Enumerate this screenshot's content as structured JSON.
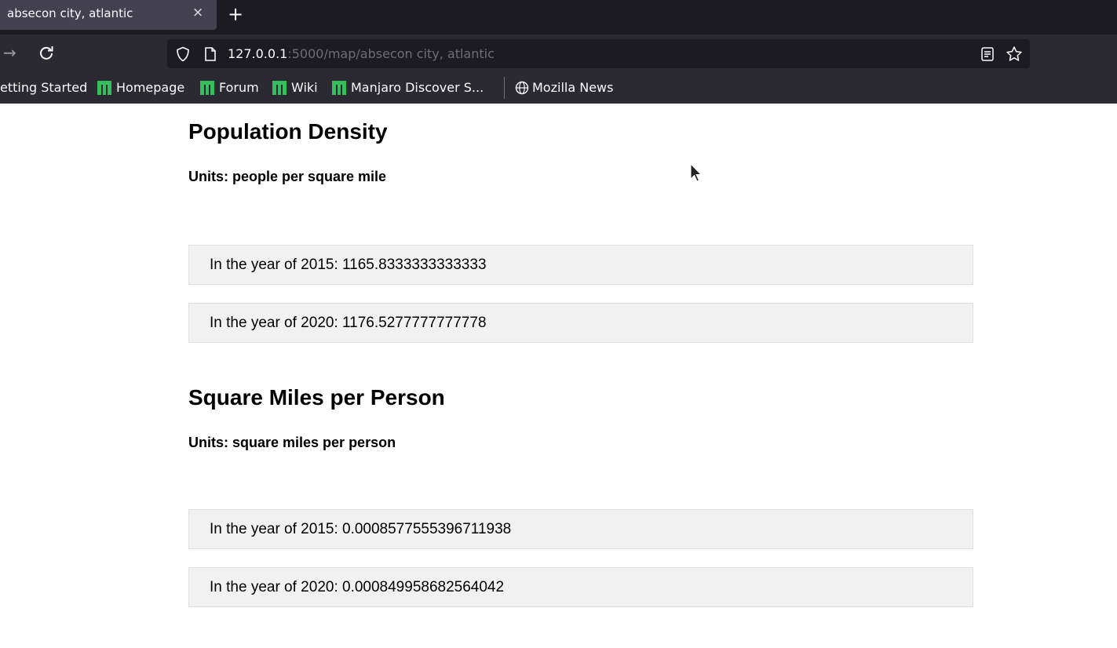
{
  "browser": {
    "tab_title": "absecon city, atlantic",
    "tab_close": "×",
    "new_tab": "+",
    "url_host": "127.0.0.1",
    "url_path": ":5000/map/absecon city, atlantic",
    "bookmarks": [
      {
        "label": "etting Started",
        "icon": "none"
      },
      {
        "label": "Homepage",
        "icon": "manjaro-icon"
      },
      {
        "label": "Forum",
        "icon": "manjaro-icon"
      },
      {
        "label": "Wiki",
        "icon": "manjaro-icon"
      },
      {
        "label": "Manjaro Discover S...",
        "icon": "manjaro-icon"
      },
      {
        "label": "Mozilla News",
        "icon": "globe-icon"
      }
    ],
    "colors": {
      "tab_bar": "#1c1b22",
      "toolbar": "#2b2a33",
      "manjaro_green": "#35bf5c"
    }
  },
  "sections": [
    {
      "title": "Population Density",
      "units": "Units: people per square mile",
      "entries": [
        "In the year of 2015: 1165.8333333333333",
        "In the year of 2020: 1176.5277777777778"
      ]
    },
    {
      "title": "Square Miles per Person",
      "units": "Units: square miles per person",
      "entries": [
        "In the year of 2015: 0.0008577555396711938",
        "In the year of 2020: 0.000849958682564042"
      ]
    }
  ]
}
